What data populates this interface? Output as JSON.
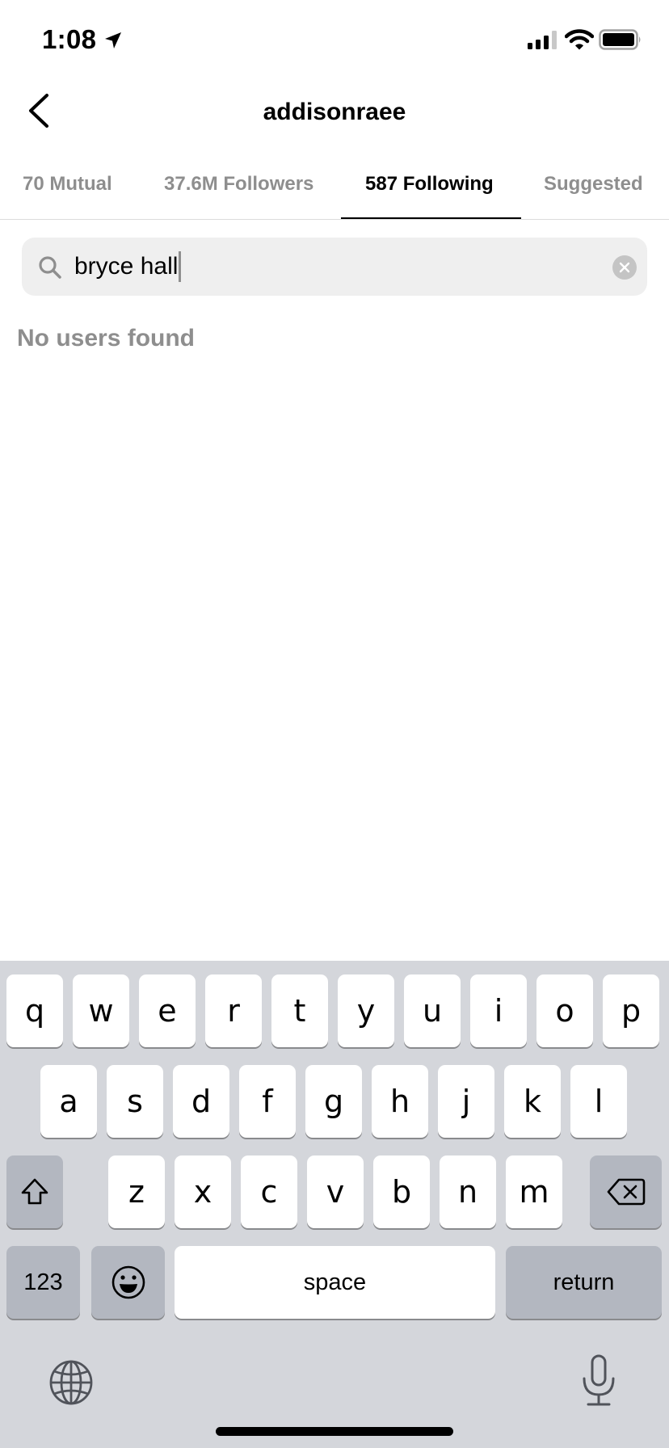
{
  "status_bar": {
    "time": "1:08",
    "icons": [
      "location-arrow-icon",
      "cellular-signal-icon",
      "wifi-icon",
      "battery-icon"
    ]
  },
  "header": {
    "title": "addisonraee",
    "back_icon": "chevron-left-icon"
  },
  "tabs": [
    {
      "label": "70 Mutual",
      "active": false
    },
    {
      "label": "37.6M Followers",
      "active": false
    },
    {
      "label": "587 Following",
      "active": true
    },
    {
      "label": "Suggested",
      "active": false
    }
  ],
  "search": {
    "value": "bryce hall",
    "icon": "search-icon",
    "clear_icon": "clear-icon"
  },
  "results": {
    "empty_message": "No users found"
  },
  "keyboard": {
    "row1": [
      "q",
      "w",
      "e",
      "r",
      "t",
      "y",
      "u",
      "i",
      "o",
      "p"
    ],
    "row2": [
      "a",
      "s",
      "d",
      "f",
      "g",
      "h",
      "j",
      "k",
      "l"
    ],
    "row3": [
      "z",
      "x",
      "c",
      "v",
      "b",
      "n",
      "m"
    ],
    "numbers_label": "123",
    "space_label": "space",
    "return_label": "return",
    "special_icons": [
      "shift-icon",
      "backspace-icon",
      "emoji-icon",
      "globe-icon",
      "microphone-icon"
    ]
  },
  "colors": {
    "active_tab": "#000000",
    "inactive_tab": "#8e8e8e",
    "search_bg": "#efefef",
    "keyboard_bg": "#d4d6db",
    "special_key_bg": "#b3b7c0"
  }
}
